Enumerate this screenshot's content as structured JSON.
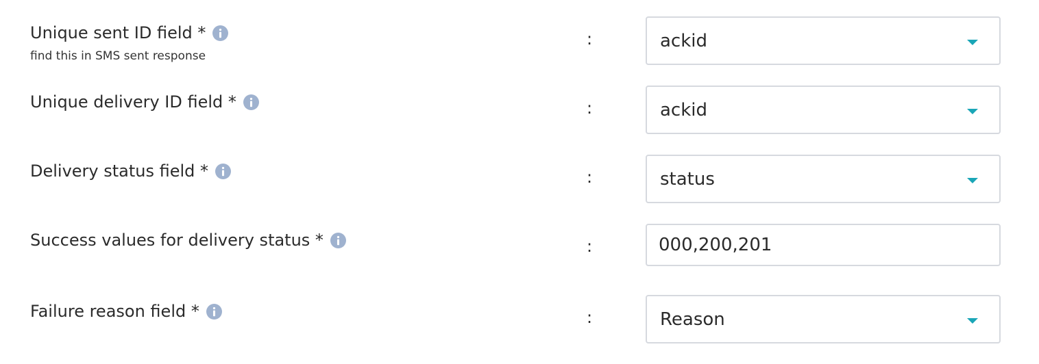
{
  "form": {
    "rows": [
      {
        "label": "Unique sent ID field *",
        "hint": "find this in SMS sent response",
        "colon": ":",
        "value": "ackid",
        "type": "select"
      },
      {
        "label": "Unique delivery ID field *",
        "colon": ":",
        "value": "ackid",
        "type": "select"
      },
      {
        "label": "Delivery status field *",
        "colon": ":",
        "value": "status",
        "type": "select"
      },
      {
        "label": "Success values for delivery status *",
        "colon": ":",
        "value": "000,200,201",
        "type": "text"
      },
      {
        "label": "Failure reason field *",
        "colon": ":",
        "value": "Reason",
        "type": "select"
      }
    ]
  },
  "icons": {
    "info": "info-icon",
    "dropdown": "chevron-down-icon"
  },
  "colors": {
    "info_icon": "#9fb2cf",
    "caret": "#1aa6b7",
    "border": "#d6d9df",
    "text": "#2b2b2b"
  }
}
